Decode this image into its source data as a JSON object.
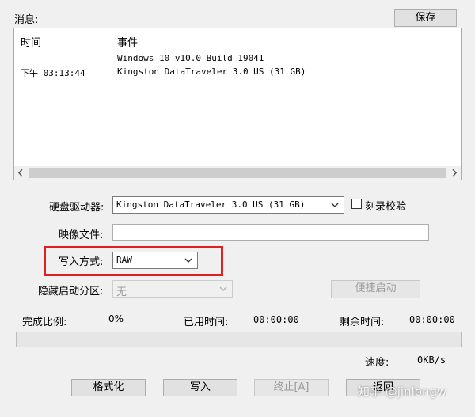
{
  "messages": {
    "label": "消息:",
    "save_label": "保存",
    "col_time": "时间",
    "col_event": "事件",
    "rows": [
      {
        "time": "",
        "event": "Windows 10 v10.0 Build 19041"
      },
      {
        "time": "下午 03:13:44",
        "event": "Kingston DataTraveler 3.0 US (31 GB)"
      }
    ]
  },
  "form": {
    "drive_label": "硬盘驱动器:",
    "drive_value": "Kingston DataTraveler 3.0 US (31 GB)",
    "verify_label": "刻录校验",
    "image_label": "映像文件:",
    "image_value": "",
    "write_mode_label": "写入方式:",
    "write_mode_value": "RAW",
    "hidden_partition_label": "隐藏启动分区:",
    "hidden_partition_value": "无",
    "quick_boot_label": "便捷启动"
  },
  "status": {
    "complete_label": "完成比例:",
    "complete_value": "0%",
    "elapsed_label": "已用时间:",
    "elapsed_value": "00:00:00",
    "remaining_label": "剩余时间:",
    "remaining_value": "00:00:00",
    "speed_label": "速度:",
    "speed_value": "0KB/s",
    "progress": 0
  },
  "buttons": {
    "format": "格式化",
    "write": "写入",
    "stop": "终止[A]",
    "back": "返回"
  },
  "watermark": "知乎 @jinlongw",
  "colors": {
    "highlight": "#e02020"
  }
}
